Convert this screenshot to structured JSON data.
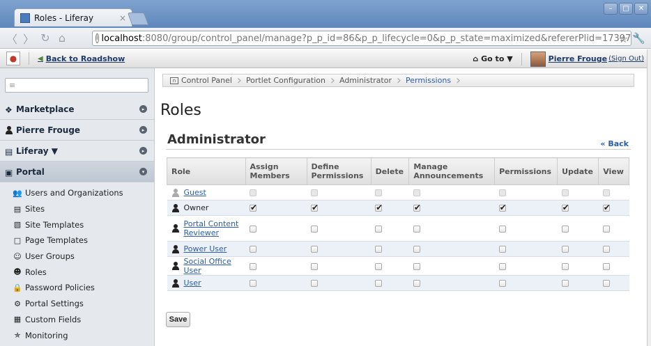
{
  "browser": {
    "tab_title": "Roles - Liferay",
    "tab_close": "×",
    "url_host": "localhost",
    "url_path": ":8080/group/control_panel/manage?p_p_id=86&p_p_lifecycle=0&p_p_state=maximized&refererPlid=17397"
  },
  "dockbar": {
    "back_label": "Back to Roadshow",
    "goto_label": "Go to ▼",
    "user_name": "Pierre Frouge",
    "sign_out": "(Sign Out)"
  },
  "sidebar": {
    "search_placeholder": "",
    "categories": [
      {
        "label": "Marketplace"
      },
      {
        "label": "Pierre Frouge"
      },
      {
        "label": "Liferay ▼"
      },
      {
        "label": "Portal"
      }
    ],
    "portal_items": [
      {
        "label": "Users and Organizations",
        "icon": "users-icon"
      },
      {
        "label": "Sites",
        "icon": "sites-icon"
      },
      {
        "label": "Site Templates",
        "icon": "site-templates-icon"
      },
      {
        "label": "Page Templates",
        "icon": "page-templates-icon"
      },
      {
        "label": "User Groups",
        "icon": "user-groups-icon"
      },
      {
        "label": "Roles",
        "icon": "roles-icon"
      },
      {
        "label": "Password Policies",
        "icon": "password-policies-icon"
      },
      {
        "label": "Portal Settings",
        "icon": "gear-icon"
      },
      {
        "label": "Custom Fields",
        "icon": "custom-fields-icon"
      },
      {
        "label": "Monitoring",
        "icon": "monitoring-icon"
      }
    ]
  },
  "breadcrumb": [
    "Control Panel",
    "Portlet Configuration",
    "Administrator",
    "Permissions"
  ],
  "main": {
    "page_title": "Roles",
    "section_title": "Administrator",
    "back_link": "« Back",
    "save_label": "Save"
  },
  "table": {
    "headers": [
      "Role",
      "Assign Members",
      "Define Permissions",
      "Delete",
      "Manage Announcements",
      "Permissions",
      "Update",
      "View"
    ],
    "rows": [
      {
        "role": "Guest",
        "link": true,
        "ghost": true,
        "perms": [
          "disabled",
          "disabled",
          "disabled",
          "disabled",
          "disabled",
          "disabled",
          "disabled"
        ]
      },
      {
        "role": "Owner",
        "link": false,
        "ghost": false,
        "perms": [
          "checked",
          "checked",
          "checked",
          "checked",
          "checked",
          "checked",
          "checked"
        ]
      },
      {
        "role": "Portal Content Reviewer",
        "link": true,
        "ghost": false,
        "perms": [
          "empty",
          "empty",
          "empty",
          "empty",
          "empty",
          "empty",
          "empty"
        ]
      },
      {
        "role": "Power User",
        "link": true,
        "ghost": false,
        "perms": [
          "empty",
          "empty",
          "empty",
          "empty",
          "empty",
          "empty",
          "empty"
        ]
      },
      {
        "role": "Social Office User",
        "link": true,
        "ghost": false,
        "perms": [
          "empty",
          "empty",
          "empty",
          "empty",
          "empty",
          "empty",
          "empty"
        ]
      },
      {
        "role": "User",
        "link": true,
        "ghost": false,
        "perms": [
          "empty",
          "empty",
          "empty",
          "empty",
          "empty",
          "empty",
          "empty"
        ]
      }
    ]
  }
}
